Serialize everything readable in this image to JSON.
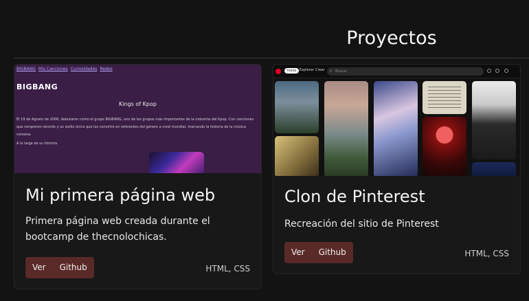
{
  "section": {
    "title": "Proyectos"
  },
  "projects": [
    {
      "title": "Mi primera página web",
      "description": "Primera página web creada durante el bootcamp de thecnolochicas.",
      "buttons": {
        "view": "Ver",
        "github": "Github"
      },
      "tech": "HTML, CSS",
      "preview": {
        "nav": [
          "BIGBANG",
          "Mis Canciones",
          "Curiosidades",
          "Redes"
        ],
        "brand": "BIGBANG",
        "heading": "Kings of Kpop",
        "paragraph": "El 19 de Agosto de 2006, debutaron como el grupo BIGBANG, uno de los grupos más importantes de la industria del Kpop. Con canciones que rompieron récords y un estilo único que los convirtió en referentes del género a nivel mundial, marcando la historia de la música coreana.",
        "small": "A la larga de su historia"
      }
    },
    {
      "title": "Clon de Pinterest",
      "description": "Recreación del sitio de Pinterest",
      "buttons": {
        "view": "Ver",
        "github": "Github"
      },
      "tech": "HTML, CSS",
      "preview": {
        "tabs": {
          "home": "Inicio",
          "explore": "Explorar",
          "create": "Crear"
        },
        "search_placeholder": "Buscar"
      }
    }
  ],
  "colors": {
    "background": "#131313",
    "button": "#5a2a28",
    "preview_purple": "#3a1e46"
  }
}
